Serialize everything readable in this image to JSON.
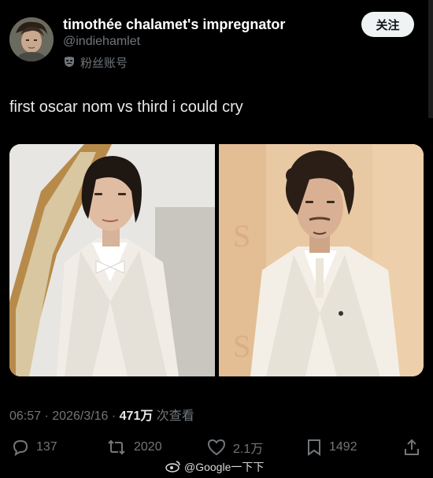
{
  "author": {
    "display_name": "timothée chalamet's impregnator",
    "handle": "@indiehamlet",
    "fan_badge_label": "粉丝账号"
  },
  "follow_button": {
    "label": "关注"
  },
  "tweet": {
    "text": "first oscar nom vs third i could cry",
    "timestamp": "06:57 · 2026/3/16 · ",
    "views_count": "471万",
    "views_label": " 次查看"
  },
  "actions": {
    "replies": "137",
    "reposts": "2020",
    "likes": "2.1万",
    "bookmarks": "1492"
  },
  "watermark": {
    "text": "@Google一下下"
  },
  "icons": {
    "avatar": "avatar",
    "fan_badge": "mask-icon",
    "reply": "reply-icon",
    "repost": "repost-icon",
    "like": "heart-icon",
    "bookmark": "bookmark-icon",
    "share": "share-icon",
    "weibo": "weibo-icon"
  },
  "colors": {
    "background": "#000000",
    "text_primary": "#e7e9ea",
    "text_secondary": "#71767b",
    "follow_button_bg": "#eff3f4"
  }
}
